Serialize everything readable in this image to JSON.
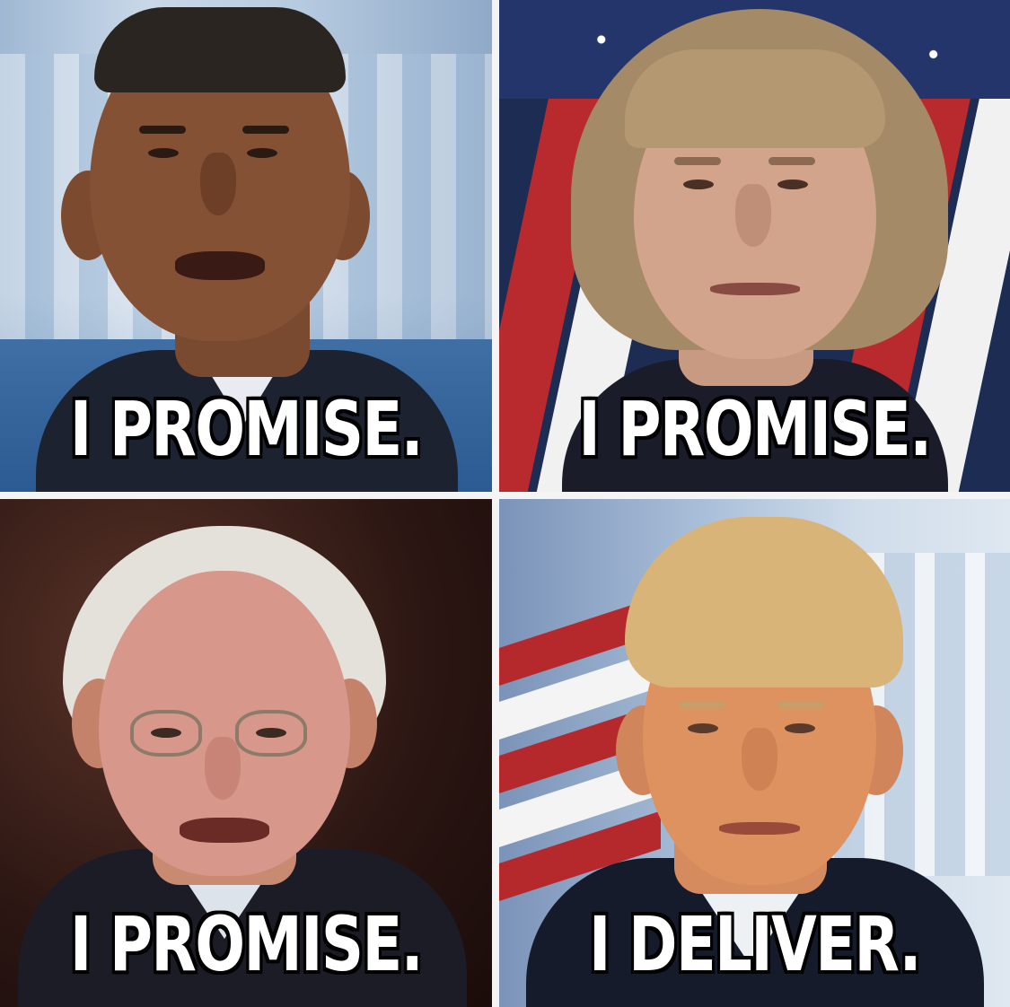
{
  "panels": [
    {
      "caption": "I PROMISE."
    },
    {
      "caption": "I PROMISE."
    },
    {
      "caption": "I PROMISE."
    },
    {
      "caption": "I DELIVER."
    }
  ],
  "colors": {
    "caption_fill": "#ffffff",
    "caption_outline": "#000000",
    "divider": "#f4f4f4"
  }
}
